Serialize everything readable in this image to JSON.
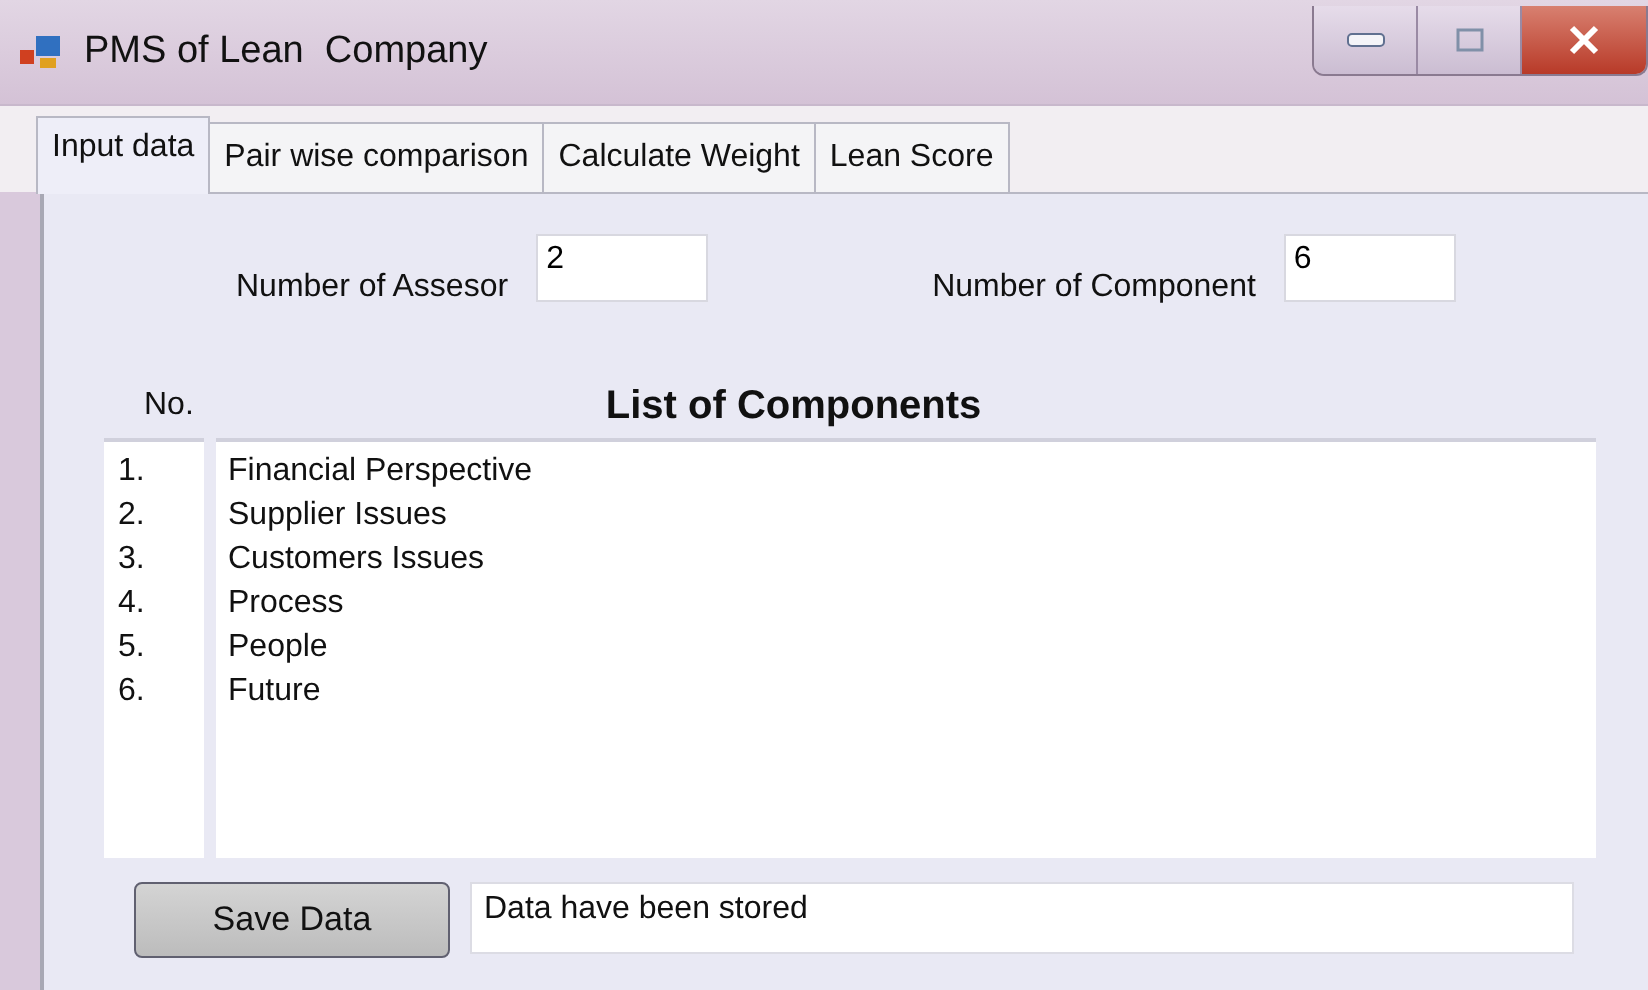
{
  "window": {
    "title": "PMS of Lean  Company"
  },
  "tabs": [
    {
      "label": "Input data",
      "selected": true
    },
    {
      "label": "Pair wise comparison",
      "selected": false
    },
    {
      "label": "Calculate Weight",
      "selected": false
    },
    {
      "label": "Lean Score",
      "selected": false
    }
  ],
  "fields": [
    {
      "label": "Number of Assesor",
      "value": "2"
    },
    {
      "label": "Number of Component",
      "value": "6"
    }
  ],
  "list": {
    "number_heading": "No.",
    "title": "List of Components",
    "items": [
      {
        "number": "1.",
        "name": "Financial Perspective"
      },
      {
        "number": "2.",
        "name": "Supplier Issues"
      },
      {
        "number": "3.",
        "name": "Customers Issues"
      },
      {
        "number": "4.",
        "name": "Process"
      },
      {
        "number": "5.",
        "name": "People"
      },
      {
        "number": "6.",
        "name": "Future"
      }
    ]
  },
  "save_button": "Save Data",
  "status": "Data have been stored"
}
